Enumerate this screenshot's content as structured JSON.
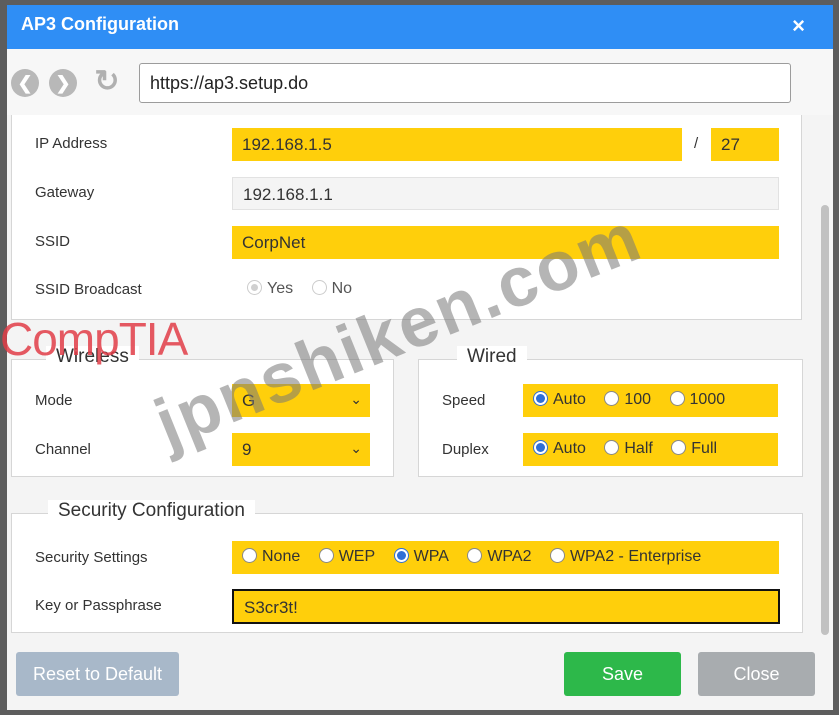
{
  "window": {
    "title": "AP3 Configuration",
    "close_glyph": "×"
  },
  "nav": {
    "back_icon": "back-arrow-icon",
    "forward_icon": "forward-arrow-icon",
    "refresh_icon": "refresh-icon",
    "url": "https://ap3.setup.do"
  },
  "network": {
    "ip_label": "IP Address",
    "ip_value": "192.168.1.5",
    "slash": "/",
    "prefix_value": "27",
    "gateway_label": "Gateway",
    "gateway_value": "192.168.1.1",
    "ssid_label": "SSID",
    "ssid_value": "CorpNet",
    "broadcast_label": "SSID Broadcast",
    "broadcast_options": [
      "Yes",
      "No"
    ]
  },
  "wireless": {
    "legend": "Wireless",
    "mode_label": "Mode",
    "mode_value": "G",
    "channel_label": "Channel",
    "channel_value": "9"
  },
  "wired": {
    "legend": "Wired",
    "speed_label": "Speed",
    "speed_options": [
      "Auto",
      "100",
      "1000"
    ],
    "speed_selected": "Auto",
    "duplex_label": "Duplex",
    "duplex_options": [
      "Auto",
      "Half",
      "Full"
    ],
    "duplex_selected": "Auto"
  },
  "security": {
    "legend": "Security Configuration",
    "settings_label": "Security Settings",
    "options": [
      "None",
      "WEP",
      "WPA",
      "WPA2",
      "WPA2 - Enterprise"
    ],
    "selected": "WPA",
    "key_label": "Key or Passphrase",
    "key_value": "S3cr3t!"
  },
  "footer": {
    "reset_label": "Reset to Default",
    "save_label": "Save",
    "close_label": "Close"
  },
  "overlays": {
    "watermark": "jpnshiken.com",
    "brand": "CompTIA"
  },
  "colors": {
    "titlebar": "#2f8ef5",
    "field_highlight": "#ffcf0b",
    "save": "#2db84a",
    "close": "#a8acaf",
    "reset": "#a8b8c9"
  }
}
